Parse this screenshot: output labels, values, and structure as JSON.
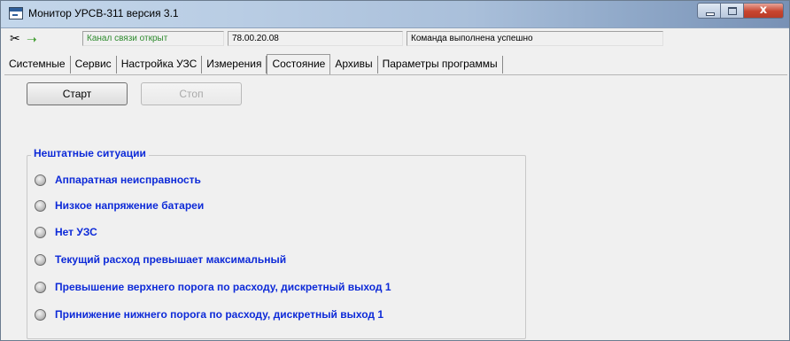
{
  "window": {
    "title": "Монитор УРСВ-311 версия 3.1",
    "close_glyph": "x"
  },
  "status": {
    "link_state": "Канал связи открыт",
    "address": "78.00.20.08",
    "message": "Команда выполнена успешно",
    "link_state_color": "#2e8b2e"
  },
  "tabs": [
    {
      "label": "Системные",
      "active": false
    },
    {
      "label": "Сервис",
      "active": false
    },
    {
      "label": "Настройка УЗС",
      "active": false
    },
    {
      "label": "Измерения",
      "active": false
    },
    {
      "label": "Состояние",
      "active": true
    },
    {
      "label": "Архивы",
      "active": false
    },
    {
      "label": "Параметры программы",
      "active": false
    }
  ],
  "controls": {
    "start_label": "Старт",
    "stop_label": "Стоп",
    "stop_enabled": false
  },
  "alarms": {
    "title": "Нештатные ситуации",
    "label_color": "#0d2ad8",
    "items": [
      {
        "label": "Аппаратная неисправность",
        "state": "off"
      },
      {
        "label": "Низкое напряжение батареи",
        "state": "off"
      },
      {
        "label": "Нет УЗС",
        "state": "off"
      },
      {
        "label": "Текущий расход превышает максимальный",
        "state": "off"
      },
      {
        "label": "Превышение верхнего порога по расходу, дискретный выход 1",
        "state": "off"
      },
      {
        "label": "Принижение нижнего порога по расходу, дискретный выход 1",
        "state": "off"
      }
    ]
  },
  "icons": {
    "plug": "plug-icon",
    "link": "link-arrow-icon",
    "app": "app-window-icon"
  }
}
